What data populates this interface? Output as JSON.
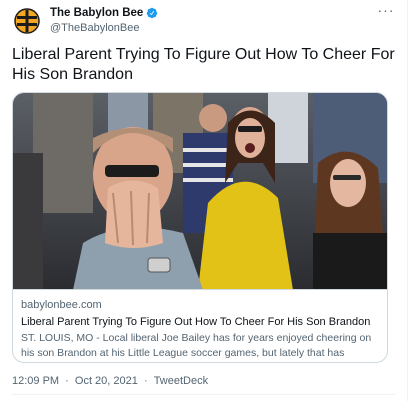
{
  "author": {
    "display_name": "The Babylon Bee",
    "handle": "@TheBabylonBee",
    "verified": true,
    "avatar_icon": "babylon-bee-logo",
    "brand_color": "#f5a623"
  },
  "tweet": {
    "text": "Liberal Parent Trying To Figure Out How To Cheer For His Son Brandon",
    "more_icon": "more-horizontal-icon"
  },
  "card": {
    "domain": "babylonbee.com",
    "title": "Liberal Parent Trying To Figure Out How To Cheer For His Son Brandon",
    "description": "ST. LOUIS, MO - Local liberal Joe Bailey has for years enjoyed cheering on his son Brandon at his Little League soccer games, but lately that has proven ..."
  },
  "meta": {
    "time": "12:09 PM",
    "separator": "·",
    "date": "Oct 20, 2021",
    "source": "TweetDeck"
  },
  "colors": {
    "text_primary": "#0f1419",
    "text_secondary": "#536471",
    "border": "#cfd9de",
    "verified_blue": "#1d9bf0"
  }
}
